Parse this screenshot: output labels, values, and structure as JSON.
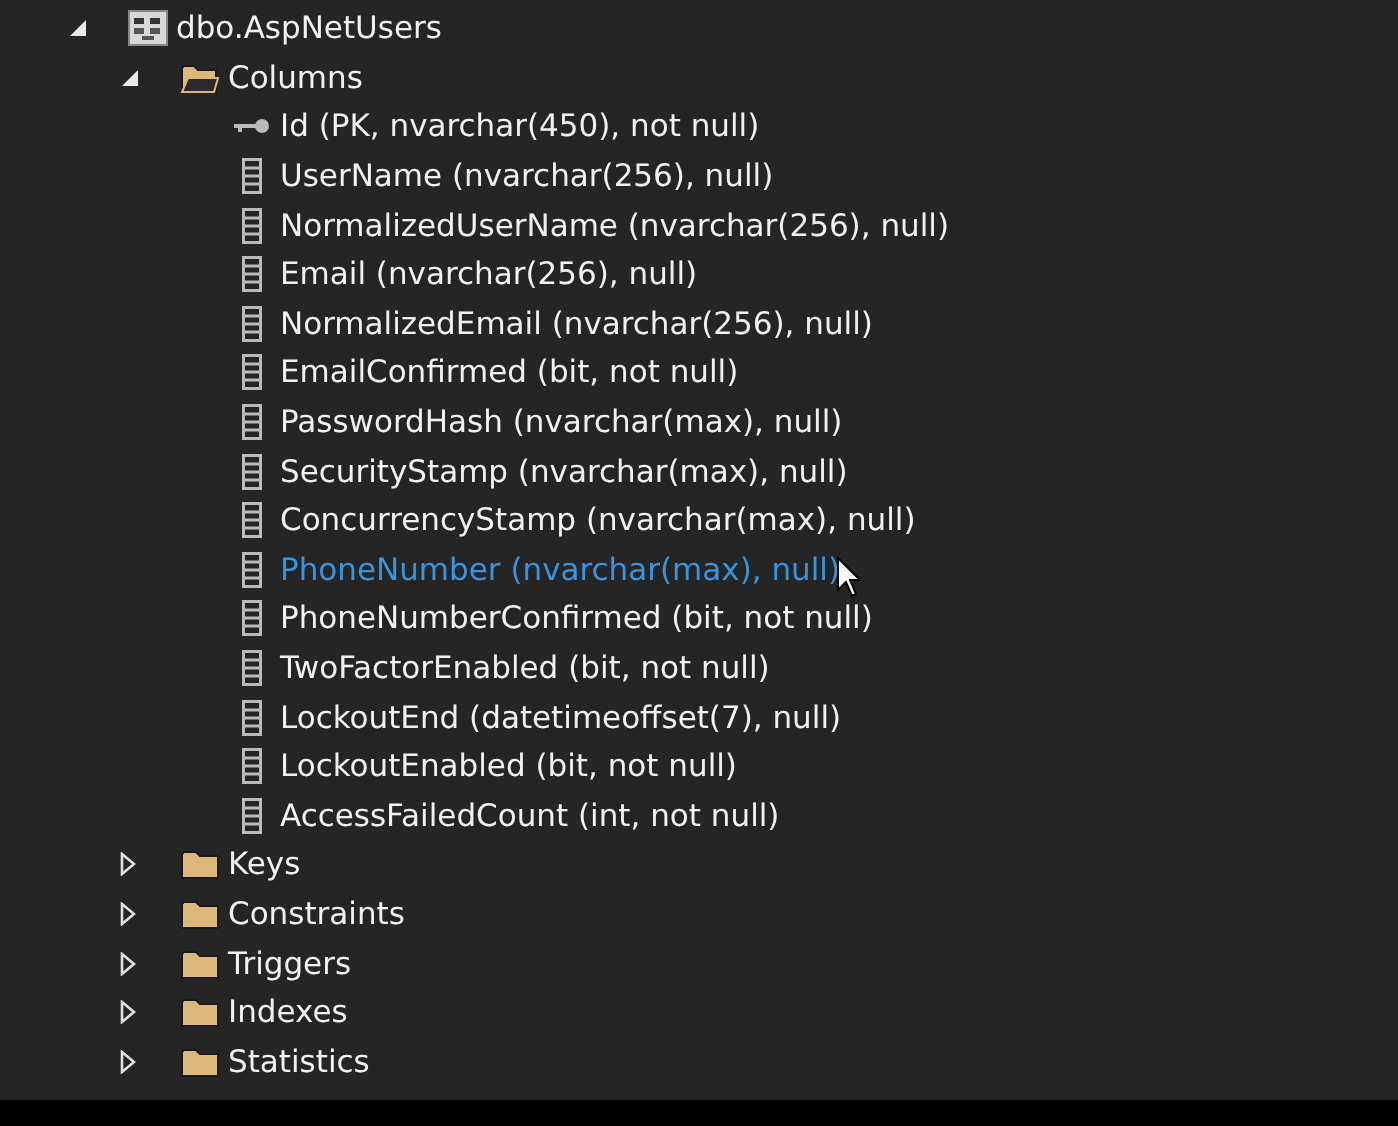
{
  "tree": [
    {
      "kind": "table",
      "label": "dbo.AspNetUsers",
      "expanded": true,
      "children": [
        {
          "kind": "folder",
          "label": "Columns",
          "expanded": true,
          "children": [
            {
              "kind": "key",
              "label": "Id (PK, nvarchar(450), not null)",
              "hovered": false
            },
            {
              "kind": "column",
              "label": "UserName (nvarchar(256), null)",
              "hovered": false
            },
            {
              "kind": "column",
              "label": "NormalizedUserName (nvarchar(256), null)",
              "hovered": false
            },
            {
              "kind": "column",
              "label": "Email (nvarchar(256), null)",
              "hovered": false
            },
            {
              "kind": "column",
              "label": "NormalizedEmail (nvarchar(256), null)",
              "hovered": false
            },
            {
              "kind": "column",
              "label": "EmailConfirmed (bit, not null)",
              "hovered": false
            },
            {
              "kind": "column",
              "label": "PasswordHash (nvarchar(max), null)",
              "hovered": false
            },
            {
              "kind": "column",
              "label": "SecurityStamp (nvarchar(max), null)",
              "hovered": false
            },
            {
              "kind": "column",
              "label": "ConcurrencyStamp (nvarchar(max), null)",
              "hovered": false
            },
            {
              "kind": "column",
              "label": "PhoneNumber (nvarchar(max), null)",
              "hovered": true
            },
            {
              "kind": "column",
              "label": "PhoneNumberConfirmed (bit, not null)",
              "hovered": false
            },
            {
              "kind": "column",
              "label": "TwoFactorEnabled (bit, not null)",
              "hovered": false
            },
            {
              "kind": "column",
              "label": "LockoutEnd (datetimeoffset(7), null)",
              "hovered": false
            },
            {
              "kind": "column",
              "label": "LockoutEnabled (bit, not null)",
              "hovered": false
            },
            {
              "kind": "column",
              "label": "AccessFailedCount (int, not null)",
              "hovered": false
            }
          ]
        },
        {
          "kind": "folder",
          "label": "Keys",
          "expanded": false
        },
        {
          "kind": "folder",
          "label": "Constraints",
          "expanded": false
        },
        {
          "kind": "folder",
          "label": "Triggers",
          "expanded": false
        },
        {
          "kind": "folder",
          "label": "Indexes",
          "expanded": false
        },
        {
          "kind": "folder",
          "label": "Statistics",
          "expanded": false
        }
      ]
    }
  ]
}
